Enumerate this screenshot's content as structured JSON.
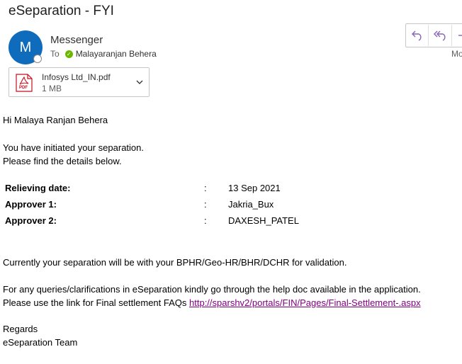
{
  "email": {
    "subject": "eSeparation - FYI",
    "sender": {
      "name": "Messenger",
      "initial": "M"
    },
    "to_label": "To",
    "recipient": "Malayaranjan Behera",
    "header_overflow_text": "Mo",
    "actions": [
      {
        "icon": "reply-icon"
      },
      {
        "icon": "reply-all-icon"
      },
      {
        "icon": "forward-icon"
      }
    ],
    "attachment": {
      "name": "Infosys Ltd_IN.pdf",
      "size": "1 MB",
      "icon_badge": "PDF"
    }
  },
  "body": {
    "greeting": "Hi Malaya Ranjan Behera",
    "intro_line1": "You have initiated your separation.",
    "intro_line2": "Please find the details below.",
    "details": [
      {
        "label": "Relieving date:",
        "colon": ":",
        "value": "13 Sep 2021"
      },
      {
        "label": "Approver 1:",
        "colon": ":",
        "value": "Jakria_Bux"
      },
      {
        "label": "Approver 2:",
        "colon": ":",
        "value": "DAXESH_PATEL"
      }
    ],
    "validation_note": "Currently your separation will be with your BPHR/Geo-HR/BHR/DCHR for validation.",
    "queries_line": "For any queries/clarifications in eSeparation kindly go through the help doc available in the application.",
    "faq_prefix": "Please use the link for Final settlement FAQs ",
    "faq_link": "http://sparshv2/portals/FIN/Pages/Final-Settlement-.aspx",
    "regards": "Regards",
    "signature": "eSeparation Team"
  },
  "colors": {
    "avatar": "#0f6cbd",
    "accent": "#8764b8",
    "link_visited": "#800080",
    "presence_ok": "#6bb700"
  }
}
